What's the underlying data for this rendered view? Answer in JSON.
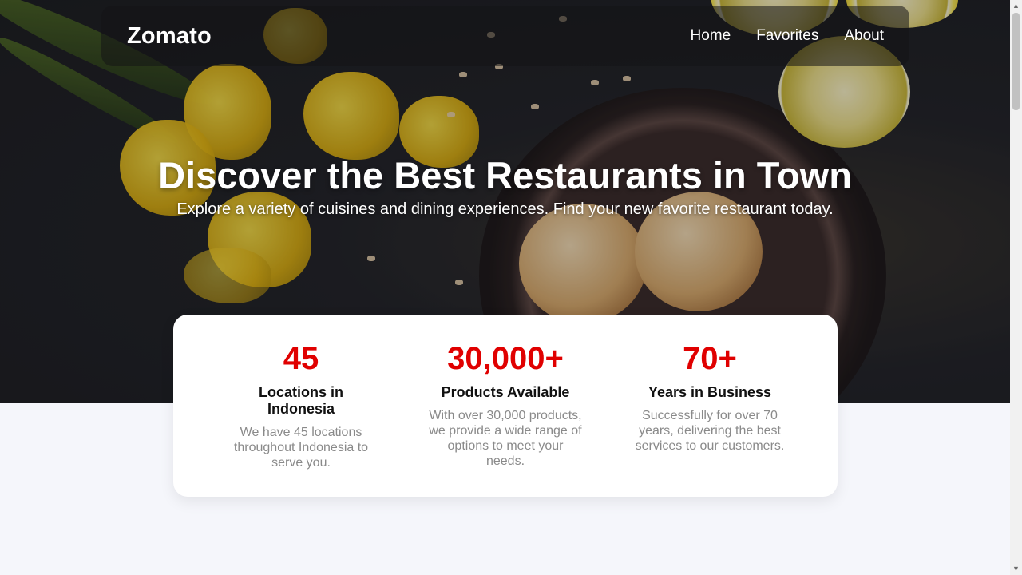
{
  "brand": "Zomato",
  "nav": {
    "links": [
      {
        "label": "Home"
      },
      {
        "label": "Favorites"
      },
      {
        "label": "About"
      }
    ]
  },
  "hero": {
    "title": "Discover the Best Restaurants in Town",
    "subtitle": "Explore a variety of cuisines and dining experiences. Find your new favorite restaurant today."
  },
  "stats": [
    {
      "value": "45",
      "title": "Locations in Indonesia",
      "description": "We have 45 locations throughout Indonesia to serve you."
    },
    {
      "value": "30,000+",
      "title": "Products Available",
      "description": "With over 30,000 products, we provide a wide range of options to meet your needs."
    },
    {
      "value": "70+",
      "title": "Years in Business",
      "description": "Successfully for over 70 years, delivering the best services to our customers."
    }
  ],
  "colors": {
    "accent": "#e00000",
    "page_bg": "#f5f6fb"
  }
}
